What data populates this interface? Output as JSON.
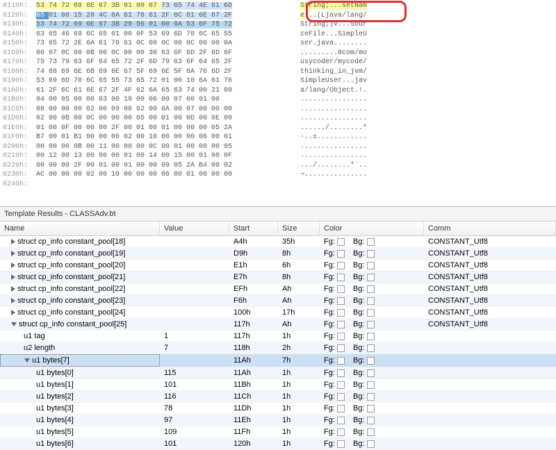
{
  "hex_rows": [
    {
      "off": "0110h:",
      "bytes": [
        {
          "t": "53 74 72 69 6E 67 3B 01 00 07 ",
          "c": "hl-yellow"
        },
        {
          "t": "73 65 74 4E 61 6D",
          "c": "hl-blue"
        }
      ],
      "asc": [
        {
          "t": "String;...",
          "c": "hl-yellow"
        },
        {
          "t": "setNam",
          "c": "hl-yellow"
        }
      ]
    },
    {
      "off": "0120h:",
      "bytes": [
        {
          "t": "65 ",
          "c": "sel"
        },
        {
          "t": "01 00 15 28 4C 6A 61 76 61 2F 6C 61 6E 67 2F",
          "c": "hl-blue"
        }
      ],
      "asc": [
        {
          "t": "e",
          "c": "hl-yellow"
        },
        {
          "t": "...(Ljava/lang/",
          "c": ""
        }
      ]
    },
    {
      "off": "0130h:",
      "bytes": [
        {
          "t": "53 74 72 69 6E 67 3B 29 56 01 00 0A 53 6F 75 72",
          "c": "hl-darkblue"
        }
      ],
      "asc": [
        {
          "t": "String;)V...Sour",
          "c": ""
        }
      ]
    },
    {
      "off": "0140h:",
      "bytes": [
        {
          "t": "63 65 46 69 6C 65 01 00 0F 53 69 6D 70 6C 65 55",
          "c": ""
        }
      ],
      "asc": [
        {
          "t": "ceFile...SimpleU",
          "c": ""
        }
      ]
    },
    {
      "off": "0150h:",
      "bytes": [
        {
          "t": "73 65 72 2E 6A 61 76 61 0C 00 0C 00 0C 00 00 0A",
          "c": ""
        }
      ],
      "asc": [
        {
          "t": "ser.java........",
          "c": ""
        }
      ]
    },
    {
      "off": "0160h:",
      "bytes": [
        {
          "t": "00 07 0C 00 0B 00 0C 00 00 30 63 6F 6D 2F 6D 6F",
          "c": ""
        }
      ],
      "asc": [
        {
          "t": ".........0com/mo",
          "c": ""
        }
      ]
    },
    {
      "off": "0170h:",
      "bytes": [
        {
          "t": "75 73 79 63 6F 64 65 72 2F 6D 79 63 6F 64 65 2F",
          "c": ""
        }
      ],
      "asc": [
        {
          "t": "usycoder/mycode/",
          "c": ""
        }
      ]
    },
    {
      "off": "0180h:",
      "bytes": [
        {
          "t": "74 68 69 6E 6B 69 6E 67 5F 69 6E 5F 6A 76 6D 2F",
          "c": ""
        }
      ],
      "asc": [
        {
          "t": "thinking_in_jvm/",
          "c": ""
        }
      ]
    },
    {
      "off": "0190h:",
      "bytes": [
        {
          "t": "53 69 6D 70 6C 65 55 73 65 72 01 00 10 6A 61 76",
          "c": ""
        }
      ],
      "asc": [
        {
          "t": "SimpleUser...jav",
          "c": ""
        }
      ]
    },
    {
      "off": "01A0h:",
      "bytes": [
        {
          "t": "61 2F 6C 61 6E 67 2F 4F 62 6A 65 63 74 00 21 00",
          "c": ""
        }
      ],
      "asc": [
        {
          "t": "a/lang/Object.!.",
          "c": ""
        }
      ]
    },
    {
      "off": "01B0h:",
      "bytes": [
        {
          "t": "04 00 05 00 00 03 00 19 00 06 00 07 00 01 00",
          "c": ""
        }
      ],
      "asc": [
        {
          "t": "................",
          "c": ""
        }
      ]
    },
    {
      "off": "01C0h:",
      "bytes": [
        {
          "t": "08 00 00 00 02 00 09 00 02 00 0A 00 07 00 00 00",
          "c": ""
        }
      ],
      "asc": [
        {
          "t": "................",
          "c": ""
        }
      ]
    },
    {
      "off": "01D0h:",
      "bytes": [
        {
          "t": "02 00 0B 00 0C 00 00 00 05 00 01 00 0D 00 0E 00",
          "c": ""
        }
      ],
      "asc": [
        {
          "t": "................",
          "c": ""
        }
      ]
    },
    {
      "off": "01E0h:",
      "bytes": [
        {
          "t": "01 00 0F 00 00 00 2F 00 01 00 01 00 00 00 05 2A",
          "c": ""
        }
      ],
      "asc": [
        {
          "t": "....../........*",
          "c": ""
        }
      ]
    },
    {
      "off": "01F0h:",
      "bytes": [
        {
          "t": "B7 00 01 B1 00 00 00 02 00 10 00 00 00 06 00 01",
          "c": ""
        }
      ],
      "asc": [
        {
          "t": "·..±............",
          "c": ""
        }
      ]
    },
    {
      "off": "0200h:",
      "bytes": [
        {
          "t": "00 00 00 0B 00 11 00 00 00 0C 00 01 00 00 00 05",
          "c": ""
        }
      ],
      "asc": [
        {
          "t": "................",
          "c": ""
        }
      ]
    },
    {
      "off": "0210h:",
      "bytes": [
        {
          "t": "00 12 00 13 00 00 00 01 00 14 00 15 00 01 00 0F",
          "c": ""
        }
      ],
      "asc": [
        {
          "t": "................",
          "c": ""
        }
      ]
    },
    {
      "off": "0220h:",
      "bytes": [
        {
          "t": "00 00 00 2F 00 01 00 01 00 00 00 05 2A B4 00 02",
          "c": ""
        }
      ],
      "asc": [
        {
          "t": ".../........*´..",
          "c": ""
        }
      ]
    },
    {
      "off": "0230h:",
      "bytes": [
        {
          "t": "AC 00 00 00 02 00 10 00 00 00 06 00 01 00 00 00",
          "c": ""
        }
      ],
      "asc": [
        {
          "t": "¬...............",
          "c": ""
        }
      ]
    },
    {
      "off": "0240h:",
      "bytes": [
        {
          "t": "",
          "c": ""
        }
      ],
      "asc": [
        {
          "t": "",
          "c": ""
        }
      ]
    }
  ],
  "template_title": "Template Results - CLASSAdv.bt",
  "headers": {
    "name": "Name",
    "value": "Value",
    "start": "Start",
    "size": "Size",
    "color": "Color",
    "comm": "Comm"
  },
  "rows": [
    {
      "indent": 1,
      "tri": "r",
      "name": "struct cp_info constant_pool[18]",
      "value": "",
      "start": "A4h",
      "size": "35h",
      "fg": true,
      "bg": true,
      "comm": "CONSTANT_Utf8",
      "alt": false
    },
    {
      "indent": 1,
      "tri": "r",
      "name": "struct cp_info constant_pool[19]",
      "value": "",
      "start": "D9h",
      "size": "8h",
      "fg": true,
      "bg": true,
      "comm": "CONSTANT_Utf8",
      "alt": true
    },
    {
      "indent": 1,
      "tri": "r",
      "name": "struct cp_info constant_pool[20]",
      "value": "",
      "start": "E1h",
      "size": "6h",
      "fg": true,
      "bg": true,
      "comm": "CONSTANT_Utf8",
      "alt": false
    },
    {
      "indent": 1,
      "tri": "r",
      "name": "struct cp_info constant_pool[21]",
      "value": "",
      "start": "E7h",
      "size": "8h",
      "fg": true,
      "bg": true,
      "comm": "CONSTANT_Utf8",
      "alt": true
    },
    {
      "indent": 1,
      "tri": "r",
      "name": "struct cp_info constant_pool[22]",
      "value": "",
      "start": "EFh",
      "size": "Ah",
      "fg": true,
      "bg": true,
      "comm": "CONSTANT_Utf8",
      "alt": false
    },
    {
      "indent": 1,
      "tri": "r",
      "name": "struct cp_info constant_pool[23]",
      "value": "",
      "start": "F6h",
      "size": "Ah",
      "fg": true,
      "bg": true,
      "comm": "CONSTANT_Utf8",
      "alt": true
    },
    {
      "indent": 1,
      "tri": "r",
      "name": "struct cp_info constant_pool[24]",
      "value": "",
      "start": "100h",
      "size": "17h",
      "fg": true,
      "bg": true,
      "comm": "CONSTANT_Utf8",
      "alt": false
    },
    {
      "indent": 1,
      "tri": "d",
      "name": "struct cp_info constant_pool[25]",
      "value": "",
      "start": "117h",
      "size": "Ah",
      "fg": true,
      "bg": true,
      "comm": "CONSTANT_Utf8",
      "alt": true
    },
    {
      "indent": 2,
      "tri": "",
      "name": "u1 tag",
      "value": "1",
      "start": "117h",
      "size": "1h",
      "fg": true,
      "bg": true,
      "comm": "",
      "alt": false
    },
    {
      "indent": 2,
      "tri": "",
      "name": "u2 length",
      "value": "7",
      "start": "118h",
      "size": "2h",
      "fg": true,
      "bg": true,
      "comm": "",
      "alt": true
    },
    {
      "indent": 2,
      "tri": "d",
      "name": "u1 bytes[7]",
      "value": "",
      "start": "11Ah",
      "size": "7h",
      "fg": true,
      "bg": true,
      "comm": "",
      "alt": false,
      "sel": true
    },
    {
      "indent": 3,
      "tri": "",
      "name": "u1 bytes[0]",
      "value": "115",
      "start": "11Ah",
      "size": "1h",
      "fg": true,
      "bg": true,
      "comm": "",
      "alt": true
    },
    {
      "indent": 3,
      "tri": "",
      "name": "u1 bytes[1]",
      "value": "101",
      "start": "11Bh",
      "size": "1h",
      "fg": true,
      "bg": true,
      "comm": "",
      "alt": false
    },
    {
      "indent": 3,
      "tri": "",
      "name": "u1 bytes[2]",
      "value": "116",
      "start": "11Ch",
      "size": "1h",
      "fg": true,
      "bg": true,
      "comm": "",
      "alt": true
    },
    {
      "indent": 3,
      "tri": "",
      "name": "u1 bytes[3]",
      "value": "78",
      "start": "11Dh",
      "size": "1h",
      "fg": true,
      "bg": true,
      "comm": "",
      "alt": false
    },
    {
      "indent": 3,
      "tri": "",
      "name": "u1 bytes[4]",
      "value": "97",
      "start": "11Eh",
      "size": "1h",
      "fg": true,
      "bg": true,
      "comm": "",
      "alt": true
    },
    {
      "indent": 3,
      "tri": "",
      "name": "u1 bytes[5]",
      "value": "109",
      "start": "11Fh",
      "size": "1h",
      "fg": true,
      "bg": true,
      "comm": "",
      "alt": false
    },
    {
      "indent": 3,
      "tri": "",
      "name": "u1 bytes[6]",
      "value": "101",
      "start": "120h",
      "size": "1h",
      "fg": true,
      "bg": true,
      "comm": "",
      "alt": true
    }
  ],
  "color_labels": {
    "fg": "Fg:",
    "bg": "Bg:"
  }
}
